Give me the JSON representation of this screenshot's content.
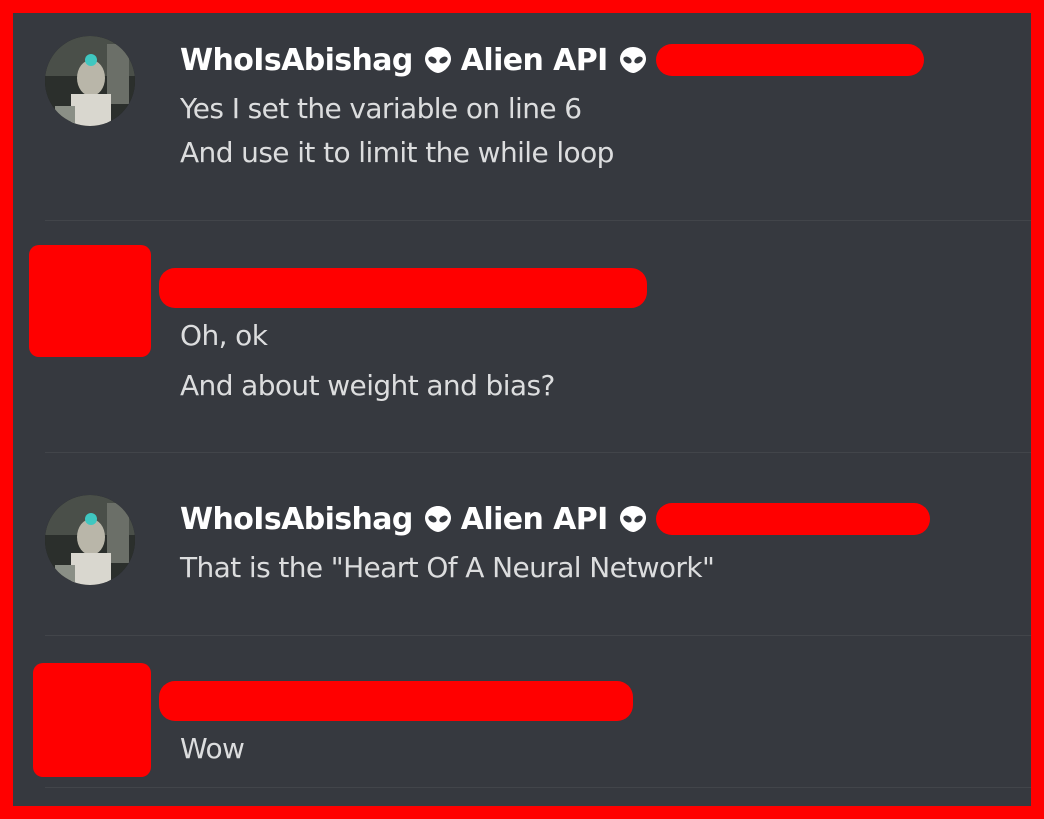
{
  "messages": [
    {
      "author": "WhoIsAbishag",
      "tag": "Alien API",
      "author_icon": "alien-icon",
      "lines": [
        "Yes I set the variable on line 6",
        "And use it to limit the while loop"
      ]
    },
    {
      "author": null,
      "lines": [
        "Oh, ok",
        "And about weight and bias?"
      ]
    },
    {
      "author": "WhoIsAbishag",
      "tag": "Alien API",
      "author_icon": "alien-icon",
      "lines": [
        "That is the \"Heart Of A Neural Network\""
      ]
    },
    {
      "author": null,
      "lines": [
        "Wow"
      ]
    }
  ],
  "colors": {
    "background": "#36393f",
    "redaction": "#ff0000",
    "username": "#ffffff",
    "message_text": "#dcddde"
  }
}
